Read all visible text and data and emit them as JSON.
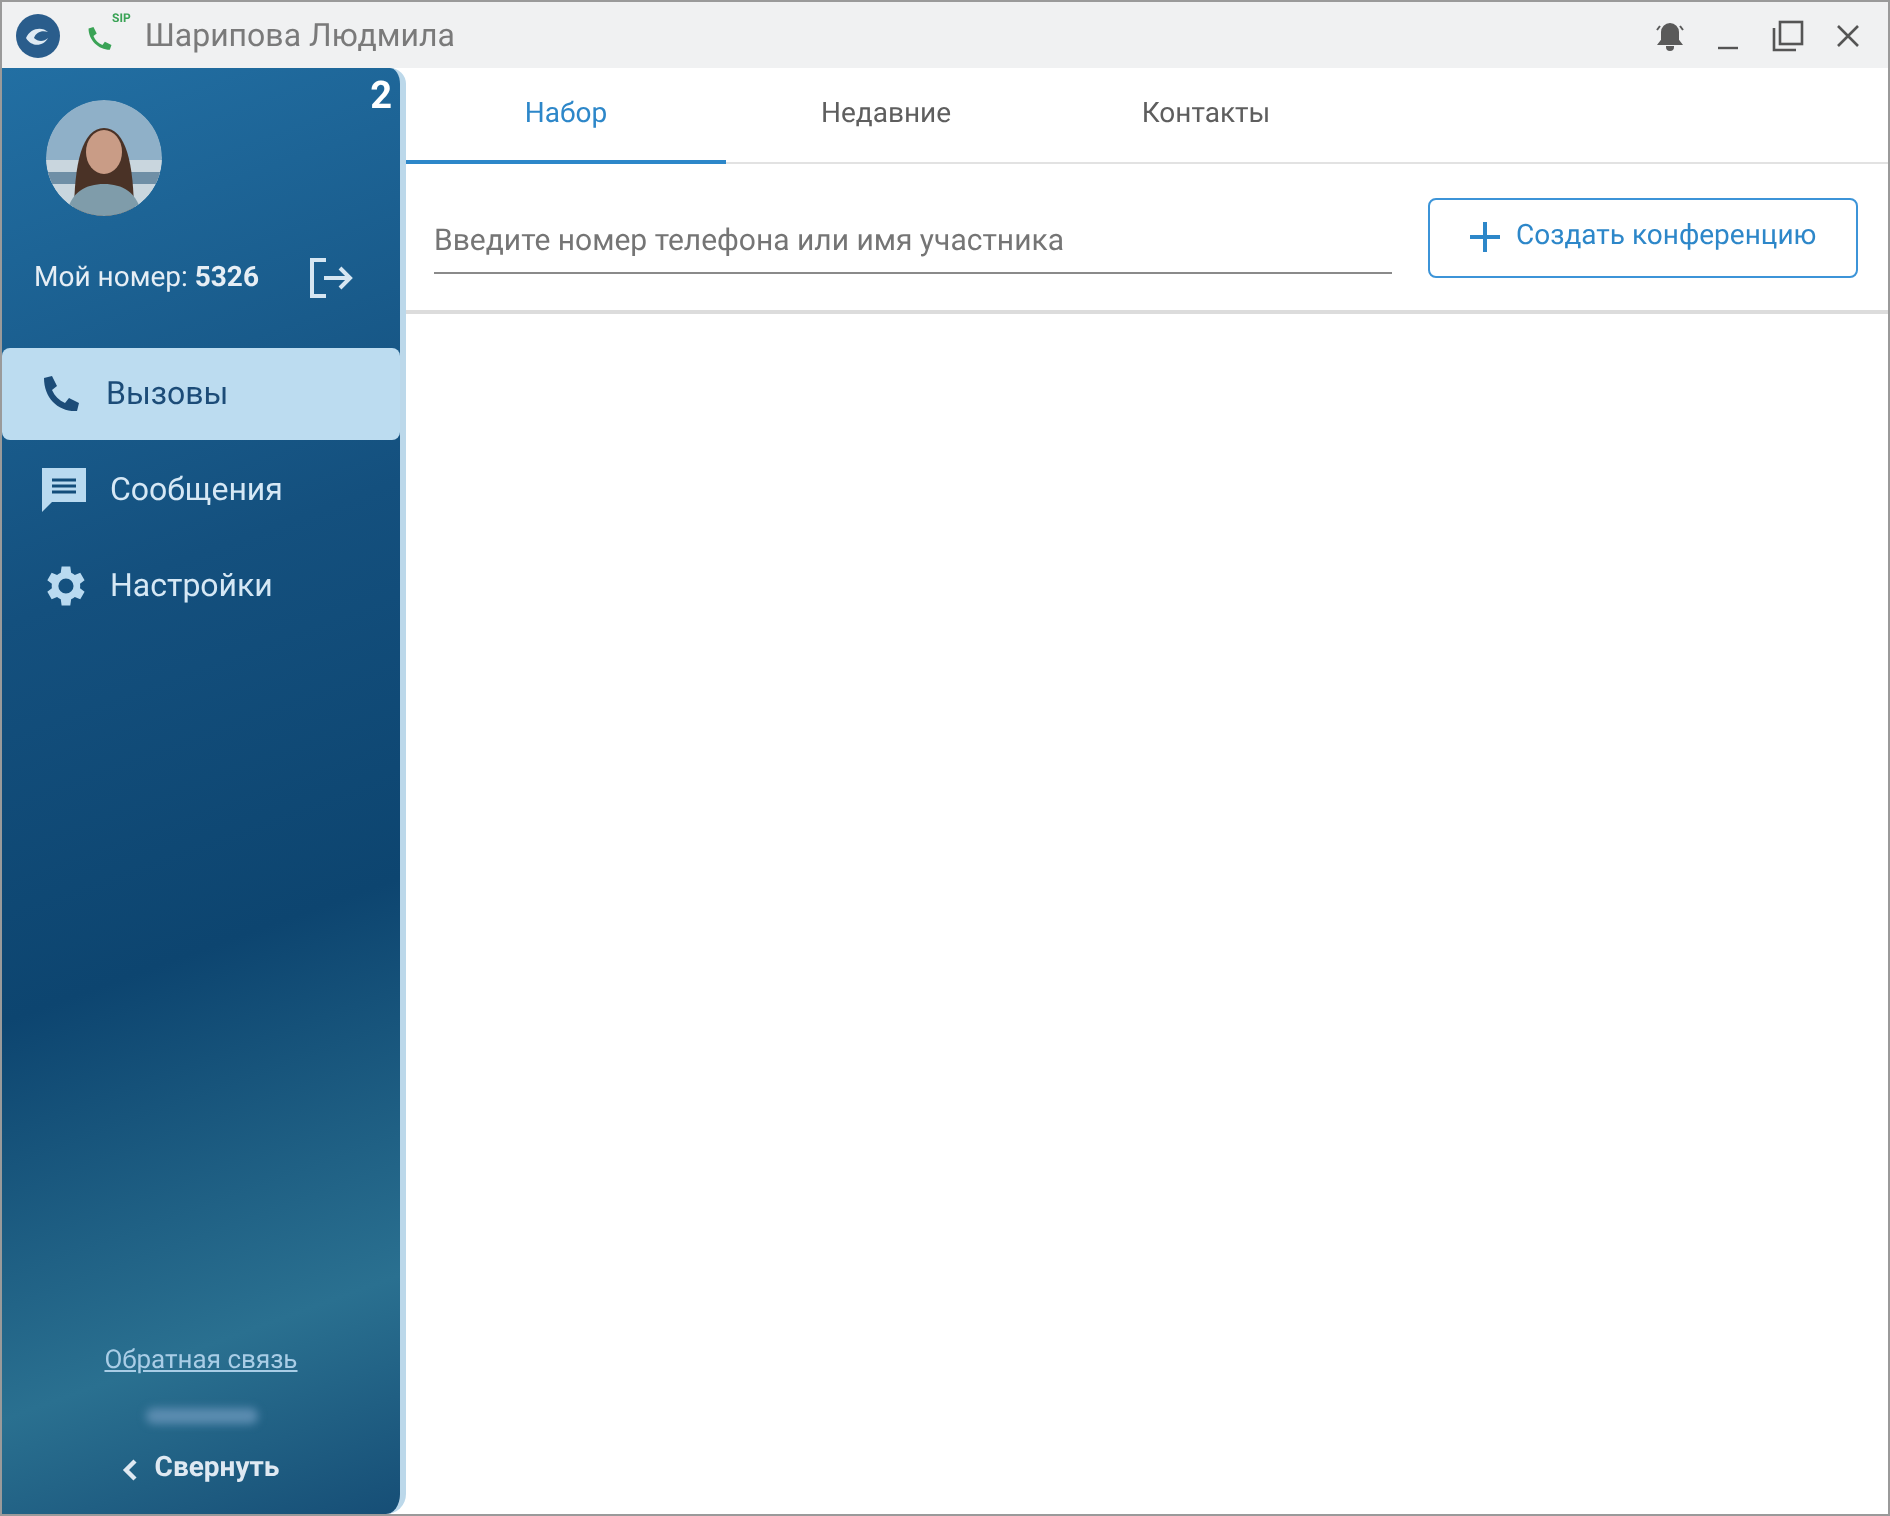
{
  "window": {
    "sip_label": "SIP",
    "title": "Шарипова Людмила"
  },
  "sidebar": {
    "badge": "2",
    "my_number_label": "Мой номер:",
    "my_number": "5326",
    "items": [
      {
        "kind": "calls",
        "label": "Вызовы",
        "selected": true
      },
      {
        "kind": "messages",
        "label": "Сообщения",
        "selected": false
      },
      {
        "kind": "settings",
        "label": "Настройки",
        "selected": false
      }
    ],
    "feedback_link": "Обратная связь",
    "collapse": "Свернуть"
  },
  "tabs": [
    {
      "label": "Набор",
      "selected": true
    },
    {
      "label": "Недавние",
      "selected": false
    },
    {
      "label": "Контакты",
      "selected": false
    }
  ],
  "search": {
    "placeholder": "Введите номер телефона или имя участника"
  },
  "conference_button": "Создать конференцию"
}
